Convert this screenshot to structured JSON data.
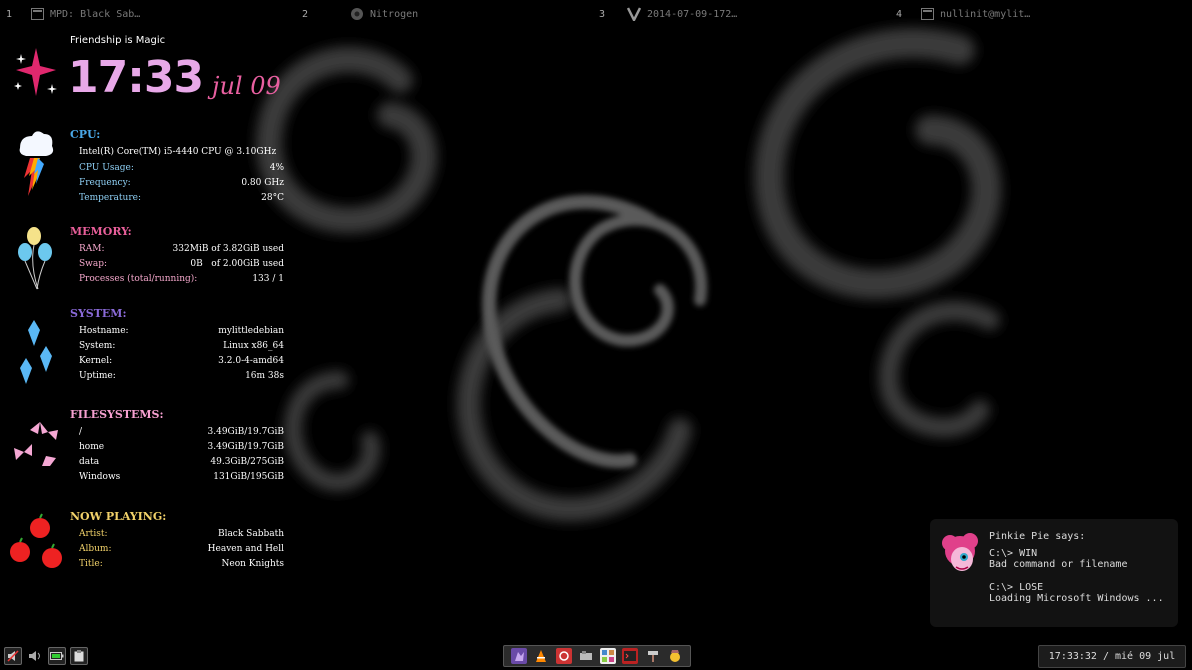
{
  "workspaces": [
    {
      "num": "1",
      "icon": "terminal-icon",
      "title": "MPD: Black Sab…"
    },
    {
      "num": "2",
      "icon": "nitrogen-icon",
      "title": "Nitrogen"
    },
    {
      "num": "3",
      "icon": "vim-icon",
      "title": "2014-07-09-172…"
    },
    {
      "num": "4",
      "icon": "terminal-icon",
      "title": "nullinit@mylit…"
    }
  ],
  "conky": {
    "motto": "Friendship is Magic",
    "time": "17:33",
    "date": "jul 09",
    "cpu": {
      "title": "CPU:",
      "model": "Intel(R) Core(TM) i5-4440 CPU @ 3.10GHz",
      "rows": [
        {
          "label": "CPU Usage:",
          "value": "4%"
        },
        {
          "label": "Frequency:",
          "value": "0.80 GHz"
        },
        {
          "label": "Temperature:",
          "value": "28°C"
        }
      ]
    },
    "memory": {
      "title": "MEMORY:",
      "rows": [
        {
          "label": "RAM:",
          "value": "332MiB of 3.82GiB used"
        },
        {
          "label": "Swap:",
          "value": "0B   of 2.00GiB used"
        },
        {
          "label": "Processes (total/running):",
          "value": "133 / 1"
        }
      ]
    },
    "system": {
      "title": "SYSTEM:",
      "rows": [
        {
          "label": "Hostname:",
          "value": "mylittledebian"
        },
        {
          "label": "System:",
          "value": "Linux x86_64"
        },
        {
          "label": "Kernel:",
          "value": "3.2.0-4-amd64"
        },
        {
          "label": "Uptime:",
          "value": "16m 38s"
        }
      ]
    },
    "filesystems": {
      "title": "FILESYSTEMS:",
      "rows": [
        {
          "label": "/",
          "value": "3.49GiB/19.7GiB"
        },
        {
          "label": "home",
          "value": "3.49GiB/19.7GiB"
        },
        {
          "label": "data",
          "value": "49.3GiB/275GiB"
        },
        {
          "label": "Windows",
          "value": "131GiB/195GiB"
        }
      ]
    },
    "now_playing": {
      "title": "NOW PLAYING:",
      "rows": [
        {
          "label": "Artist:",
          "value": "Black Sabbath"
        },
        {
          "label": "Album:",
          "value": "Heaven and Hell"
        },
        {
          "label": "Title:",
          "value": "Neon Knights"
        }
      ]
    }
  },
  "notification": {
    "header": "Pinkie Pie says:",
    "line1": "C:\\> WIN",
    "line2": "Bad command or filename",
    "line3": "C:\\> LOSE",
    "line4": "Loading Microsoft Windows ..."
  },
  "clockbar": "17:33:32 / mié 09 jul",
  "colors": {
    "cpu": "#4aa8e8",
    "memory": "#e85f9a",
    "system": "#8a6ad8",
    "filesystems": "#f5a0d0",
    "now_playing": "#f2d26a",
    "clock": "#e8a8e8",
    "date": "#e85fa0"
  }
}
